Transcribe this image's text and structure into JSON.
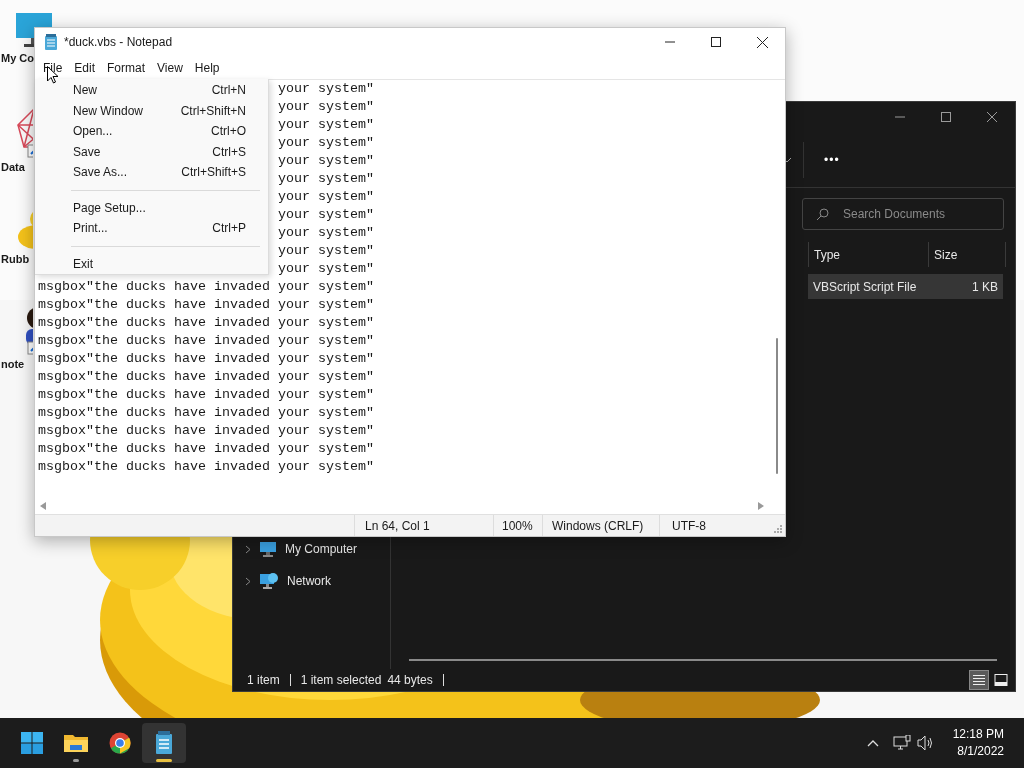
{
  "desktop": {
    "icons": [
      {
        "label": "My Co",
        "kind": "computer"
      },
      {
        "label": "Data",
        "kind": "chart"
      },
      {
        "label": "Rubb",
        "kind": "duck"
      },
      {
        "label": "note",
        "kind": "person"
      }
    ]
  },
  "explorer": {
    "toolbar": {
      "more": "•••"
    },
    "search": {
      "placeholder": "Search Documents"
    },
    "columns": [
      "Type",
      "Size"
    ],
    "rows": [
      {
        "type": "VBScript Script File",
        "size": "1 KB",
        "selected": true
      }
    ],
    "nav": [
      {
        "label": "My Computer",
        "kind": "computer"
      },
      {
        "label": "Network",
        "kind": "network"
      }
    ],
    "status": {
      "count": "1 item",
      "selection": "1 item selected",
      "bytes": "44 bytes"
    },
    "views": [
      {
        "kind": "details",
        "selected": true
      },
      {
        "kind": "tiles",
        "selected": false
      }
    ]
  },
  "notepad": {
    "title": "*duck.vbs - Notepad",
    "menu": [
      "File",
      "Edit",
      "Format",
      "View",
      "Help"
    ],
    "file_menu": [
      {
        "kind": "item",
        "label": "New",
        "shortcut": "Ctrl+N"
      },
      {
        "kind": "item",
        "label": "New Window",
        "shortcut": "Ctrl+Shift+N"
      },
      {
        "kind": "item",
        "label": "Open...",
        "shortcut": "Ctrl+O"
      },
      {
        "kind": "item",
        "label": "Save",
        "shortcut": "Ctrl+S"
      },
      {
        "kind": "item",
        "label": "Save As...",
        "shortcut": "Ctrl+Shift+S"
      },
      {
        "kind": "separator"
      },
      {
        "kind": "item",
        "label": "Page Setup..."
      },
      {
        "kind": "item",
        "label": "Print...",
        "shortcut": "Ctrl+P"
      },
      {
        "kind": "separator"
      },
      {
        "kind": "item",
        "label": "Exit"
      }
    ],
    "lines": [
      {
        "kind": "covered",
        "text": "your system\""
      },
      {
        "kind": "covered",
        "text": "your system\""
      },
      {
        "kind": "covered",
        "text": "your system\""
      },
      {
        "kind": "covered",
        "text": "your system\""
      },
      {
        "kind": "covered",
        "text": "your system\""
      },
      {
        "kind": "covered",
        "text": "your system\""
      },
      {
        "kind": "covered",
        "text": "your system\""
      },
      {
        "kind": "covered",
        "text": "your system\""
      },
      {
        "kind": "covered",
        "text": "your system\""
      },
      {
        "kind": "covered",
        "text": "your system\""
      },
      {
        "kind": "covered",
        "text": "your system\""
      },
      {
        "kind": "full",
        "text": "msgbox\"the ducks have invaded your system\""
      },
      {
        "kind": "full",
        "text": "msgbox\"the ducks have invaded your system\""
      },
      {
        "kind": "full",
        "text": "msgbox\"the ducks have invaded your system\""
      },
      {
        "kind": "full",
        "text": "msgbox\"the ducks have invaded your system\""
      },
      {
        "kind": "full",
        "text": "msgbox\"the ducks have invaded your system\""
      },
      {
        "kind": "full",
        "text": "msgbox\"the ducks have invaded your system\""
      },
      {
        "kind": "full",
        "text": "msgbox\"the ducks have invaded your system\""
      },
      {
        "kind": "full",
        "text": "msgbox\"the ducks have invaded your system\""
      },
      {
        "kind": "full",
        "text": "msgbox\"the ducks have invaded your system\""
      },
      {
        "kind": "full",
        "text": "msgbox\"the ducks have invaded your system\""
      },
      {
        "kind": "full",
        "text": "msgbox\"the ducks have invaded your system\""
      }
    ],
    "status": {
      "position": "Ln 64, Col 1",
      "zoom": "100%",
      "line_ending": "Windows (CRLF)",
      "encoding": "UTF-8"
    }
  },
  "taskbar": {
    "apps": [
      {
        "kind": "start",
        "running": false,
        "selected": false
      },
      {
        "kind": "explorer",
        "running": true,
        "selected": false
      },
      {
        "kind": "chrome",
        "running": false,
        "selected": false
      },
      {
        "kind": "notepad",
        "running": true,
        "selected": true
      }
    ],
    "time": "12:18 PM",
    "date": "8/1/2022"
  }
}
